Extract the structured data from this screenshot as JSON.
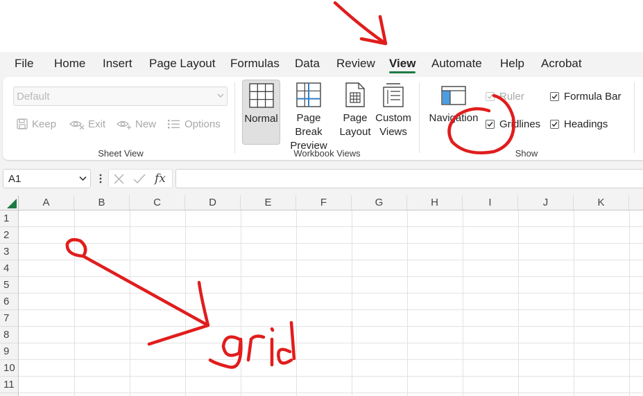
{
  "menu": {
    "tabs": [
      {
        "label": "File"
      },
      {
        "label": "Home"
      },
      {
        "label": "Insert"
      },
      {
        "label": "Page Layout"
      },
      {
        "label": "Formulas"
      },
      {
        "label": "Data"
      },
      {
        "label": "Review"
      },
      {
        "label": "View",
        "active": true
      },
      {
        "label": "Automate"
      },
      {
        "label": "Help"
      },
      {
        "label": "Acrobat"
      }
    ]
  },
  "ribbon": {
    "sheet_view": {
      "select_value": "Default",
      "keep": "Keep",
      "exit": "Exit",
      "new": "New",
      "options": "Options",
      "group_label": "Sheet View"
    },
    "workbook_views": {
      "normal": "Normal",
      "page_break_line1": "Page Break",
      "page_break_line2": "Preview",
      "page_layout_line1": "Page",
      "page_layout_line2": "Layout",
      "custom_views_line1": "Custom",
      "custom_views_line2": "Views",
      "group_label": "Workbook Views"
    },
    "show": {
      "navigation": "Navigation",
      "ruler": "Ruler",
      "ruler_checked": true,
      "ruler_disabled": true,
      "formula_bar": "Formula Bar",
      "formula_bar_checked": true,
      "gridlines": "Gridlines",
      "gridlines_checked": true,
      "headings": "Headings",
      "headings_checked": true,
      "group_label": "Show"
    }
  },
  "formula_bar": {
    "name_box": "A1",
    "fx": "fx",
    "formula": ""
  },
  "grid": {
    "columns": [
      "A",
      "B",
      "C",
      "D",
      "E",
      "F",
      "G",
      "H",
      "I",
      "J",
      "K"
    ],
    "rows": [
      "1",
      "2",
      "3",
      "4",
      "5",
      "6",
      "7",
      "8",
      "9",
      "10",
      "11"
    ]
  },
  "annotations": {
    "handwritten_text": "grid",
    "ink_color": "#e11d1d"
  },
  "colors": {
    "accent_green": "#1e7a45",
    "chrome_bg": "#f3f3f3"
  }
}
